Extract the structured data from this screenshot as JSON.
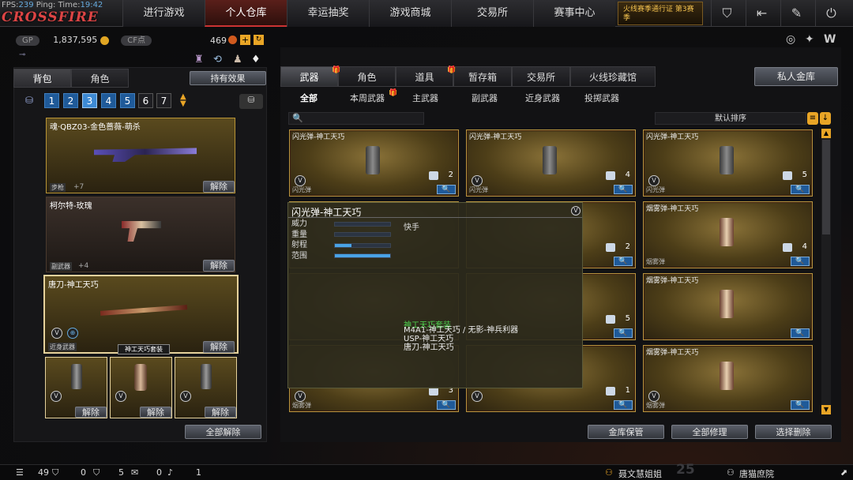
{
  "stats": {
    "fps_label": "FPS:",
    "fps": "239",
    "ping_label": "Ping:",
    "ping": "",
    "time_label": "Time:",
    "time": "19:42"
  },
  "nav": [
    "进行游戏",
    "个人仓库",
    "幸运抽奖",
    "游戏商城",
    "交易所",
    "赛事中心"
  ],
  "promo": "火线赛季通行证 第3赛季",
  "currency": {
    "gp_label": "GP",
    "gp": "1,837,595",
    "cf_label": "CF点",
    "cf": "469"
  },
  "left": {
    "tabs": [
      "背包",
      "角色"
    ],
    "holding": "持有效果",
    "pages": [
      "1",
      "2",
      "3",
      "4",
      "5",
      "6",
      "7"
    ],
    "items": [
      {
        "title": "魂·QBZ03-金色蔷薇-萌杀",
        "type": "步枪",
        "bonus": "+7",
        "btn": "解除"
      },
      {
        "title": "柯尔特-玫瑰",
        "type": "副武器",
        "bonus": "+4",
        "btn": "解除"
      },
      {
        "title": "唐刀-神工天巧",
        "type": "近身武器",
        "badge": "神工天巧套装",
        "btn": "解除"
      }
    ],
    "smalls": [
      "解除",
      "解除",
      "解除"
    ],
    "release_all": "全部解除"
  },
  "right": {
    "tabs": [
      "武器",
      "角色",
      "道具",
      "暂存箱",
      "交易所",
      "火线珍藏馆"
    ],
    "vault": "私人金库",
    "subtabs": [
      "全部",
      "本周武器",
      "主武器",
      "副武器",
      "近身武器",
      "投掷武器"
    ],
    "sort": "默认排序",
    "cards": [
      {
        "title": "闪光弹-神工天巧",
        "count": "2",
        "type": "闪光弹"
      },
      {
        "title": "闪光弹-神工天巧",
        "count": "4",
        "type": "闪光弹"
      },
      {
        "title": "闪光弹-神工天巧",
        "count": "5",
        "type": "闪光弹"
      },
      {
        "title": "",
        "count": "",
        "type": ""
      },
      {
        "title": "",
        "count": "2",
        "type": ""
      },
      {
        "title": "烟雾弹-神工天巧",
        "count": "4",
        "type": "烟雾弹"
      },
      {
        "title": "",
        "count": "",
        "type": ""
      },
      {
        "title": "",
        "count": "5",
        "type": ""
      },
      {
        "title": "烟雾弹-神工天巧",
        "count": "",
        "type": ""
      },
      {
        "title": "",
        "count": "3",
        "type": "烟雾弹"
      },
      {
        "title": "",
        "count": "1",
        "type": ""
      },
      {
        "title": "烟雾弹-神工天巧",
        "count": "",
        "type": "烟雾弹"
      }
    ],
    "actions": [
      "金库保管",
      "全部修理",
      "选择删除"
    ]
  },
  "tooltip": {
    "title": "闪光弹-神工天巧",
    "stats": [
      {
        "label": "威力",
        "value": 0
      },
      {
        "label": "重量",
        "value": 0
      },
      {
        "label": "射程",
        "value": 0.3
      },
      {
        "label": "范围",
        "value": 1.0
      }
    ],
    "note": "快手",
    "set_title": "神工天巧套装",
    "set_items": [
      "M4A1-神工天巧 / 无影-神兵利器",
      "USP-神工天巧",
      "唐刀-神工天巧"
    ]
  },
  "bottom": {
    "a": "49",
    "b": "0",
    "c": "5",
    "d": "0",
    "e": "1",
    "friend1": "聂文慧姐姐",
    "friend2": "唐猫庶院",
    "level": "25"
  },
  "colors": {
    "accent": "#c33",
    "gold": "#b8953e",
    "blue": "#1f5a99"
  }
}
